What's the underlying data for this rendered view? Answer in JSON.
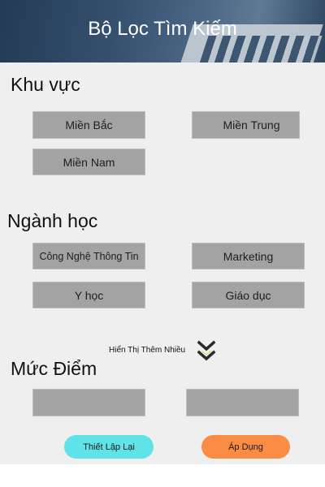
{
  "header": {
    "title": "Bộ Lọc Tìm Kiếm"
  },
  "region": {
    "heading": "Khu vực",
    "options": [
      "Miền Bắc",
      "Miền Trung",
      "Miền Nam"
    ]
  },
  "major": {
    "heading": "Ngành học",
    "options": [
      "Công Nghệ Thông Tin",
      "Marketing",
      "Y học",
      "Giáo dục"
    ],
    "show_more": "Hiển Thị Thêm Nhiều"
  },
  "score": {
    "heading": "Mức Điểm",
    "min_value": "",
    "max_value": ""
  },
  "actions": {
    "reset": "Thiết  Lập Lại",
    "apply": "Áp Dụng"
  },
  "colors": {
    "chip": "#a3a3a3",
    "reset_button": "#5fe3e8",
    "apply_button": "#fb8c43",
    "background": "#efefef"
  }
}
